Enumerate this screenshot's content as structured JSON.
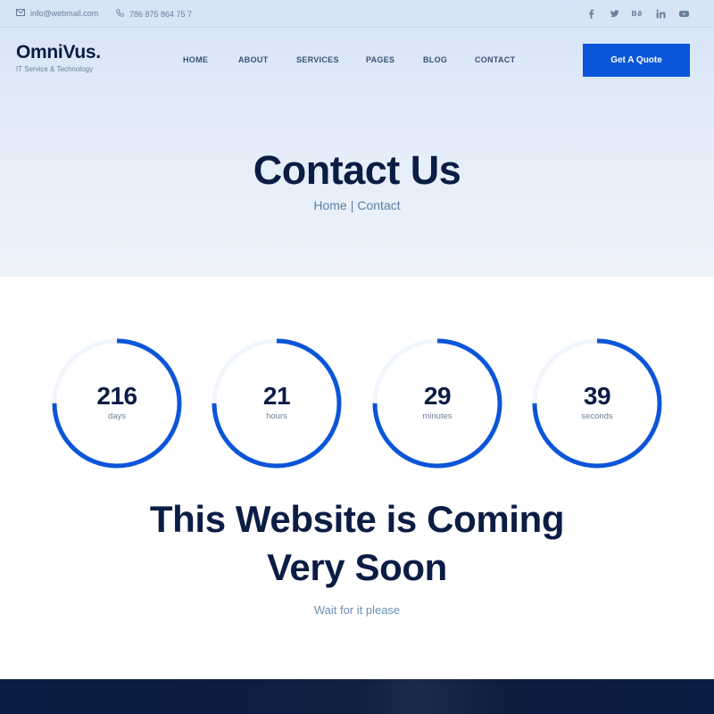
{
  "topbar": {
    "email": "info@webmail.com",
    "phone": "786 875 864 75 7",
    "socials": [
      "facebook-icon",
      "twitter-icon",
      "behance-icon",
      "linkedin-icon",
      "youtube-icon"
    ]
  },
  "brand": {
    "name": "OmniVus.",
    "tagline": "IT Service & Technology"
  },
  "nav": {
    "items": [
      {
        "label": "HOME"
      },
      {
        "label": "ABOUT"
      },
      {
        "label": "SERVICES"
      },
      {
        "label": "PAGES"
      },
      {
        "label": "BLOG"
      },
      {
        "label": "CONTACT"
      }
    ],
    "cta": "Get A Quote"
  },
  "hero": {
    "title": "Contact Us",
    "breadcrumb": {
      "home": "Home",
      "separator": "|",
      "current": "Contact"
    }
  },
  "countdown": [
    {
      "value": "216",
      "unit": "days",
      "progress": 0.75
    },
    {
      "value": "21",
      "unit": "hours",
      "progress": 0.75
    },
    {
      "value": "29",
      "unit": "minutes",
      "progress": 0.75
    },
    {
      "value": "39",
      "unit": "seconds",
      "progress": 0.75
    }
  ],
  "coming_soon": {
    "line1": "This Website is Coming",
    "line2": "Very Soon",
    "subtitle": "Wait for it please"
  },
  "colors": {
    "accent": "#0b55d9",
    "navy": "#0b1d45",
    "muted": "#6a7f9c"
  }
}
